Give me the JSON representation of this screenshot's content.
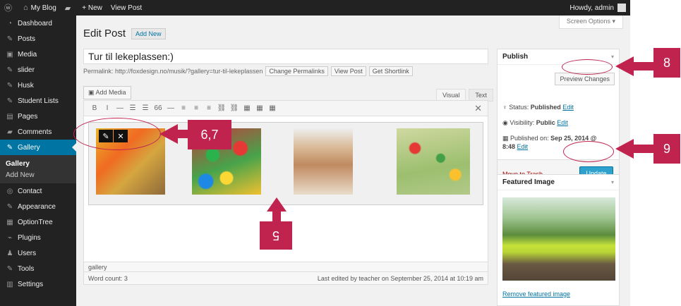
{
  "adminbar": {
    "site_name": "My Blog",
    "new_label": "+ New",
    "view_post": "View Post",
    "howdy": "Howdy, admin"
  },
  "sidebar": {
    "items": [
      {
        "label": "Dashboard",
        "icon": "dashboard-icon",
        "glyph": "◔"
      },
      {
        "label": "Posts",
        "icon": "pin-icon",
        "glyph": "✎"
      },
      {
        "label": "Media",
        "icon": "media-icon",
        "glyph": "▣"
      },
      {
        "label": "slider",
        "icon": "pin-icon",
        "glyph": "✎"
      },
      {
        "label": "Husk",
        "icon": "pin-icon",
        "glyph": "✎"
      },
      {
        "label": "Student Lists",
        "icon": "pin-icon",
        "glyph": "✎"
      },
      {
        "label": "Pages",
        "icon": "pages-icon",
        "glyph": "▤"
      },
      {
        "label": "Comments",
        "icon": "comments-icon",
        "glyph": "▰"
      },
      {
        "label": "Gallery",
        "icon": "pin-icon",
        "glyph": "✎"
      }
    ],
    "submenu": [
      "Gallery",
      "Add New"
    ],
    "items_after": [
      {
        "label": "Contact",
        "icon": "contact-icon",
        "glyph": "◎"
      },
      {
        "label": "Appearance",
        "icon": "appearance-icon",
        "glyph": "✎"
      },
      {
        "label": "OptionTree",
        "icon": "optiontree-icon",
        "glyph": "▦"
      },
      {
        "label": "Plugins",
        "icon": "plugins-icon",
        "glyph": "⌁"
      },
      {
        "label": "Users",
        "icon": "users-icon",
        "glyph": "♟"
      },
      {
        "label": "Tools",
        "icon": "tools-icon",
        "glyph": "✎"
      },
      {
        "label": "Settings",
        "icon": "settings-icon",
        "glyph": "▥"
      }
    ]
  },
  "header": {
    "screen_options": "Screen Options",
    "title": "Edit Post",
    "add_new": "Add New"
  },
  "post": {
    "title": "Tur til lekeplassen:)",
    "permalink": "Permalink: http://foxdesign.no/musik/?gallery=tur-til-lekeplassen",
    "change_permalinks": "Change Permalinks",
    "view_post": "View Post",
    "get_shortlink": "Get Shortlink"
  },
  "editor": {
    "add_media": "Add Media",
    "tab_visual": "Visual",
    "tab_text": "Text",
    "toolbar": [
      "B",
      "I",
      "—",
      "☰",
      "☰",
      "66",
      "—",
      "≡",
      "≡",
      "≡",
      "⛓",
      "⛓",
      "▦",
      "▦",
      "▦"
    ],
    "close_glyph": "✕",
    "edit_glyph": "✎",
    "remove_glyph": "✕",
    "path": "gallery",
    "word_count": "Word count: 3",
    "last_edited": "Last edited by teacher on September 25, 2014 at 10:19 am"
  },
  "publish": {
    "title": "Publish",
    "preview_changes": "Preview Changes",
    "status_label": "Status:",
    "status_value": "Published",
    "status_edit": "Edit",
    "visibility_label": "Visibility:",
    "visibility_value": "Public",
    "visibility_edit": "Edit",
    "published_label": "Published on:",
    "published_value": "Sep 25, 2014 @",
    "published_time": "8:48",
    "published_edit": "Edit",
    "move_to_trash": "Move to Trash",
    "update": "Update"
  },
  "featured": {
    "title": "Featured Image",
    "remove": "Remove featured image"
  },
  "callouts": {
    "c8": "8",
    "c67": "6,7",
    "c9": "9",
    "c5": "5"
  },
  "colors": {
    "callout": "#c0234e",
    "active_menu": "#0074a2",
    "primary_button": "#2ea2cc"
  }
}
